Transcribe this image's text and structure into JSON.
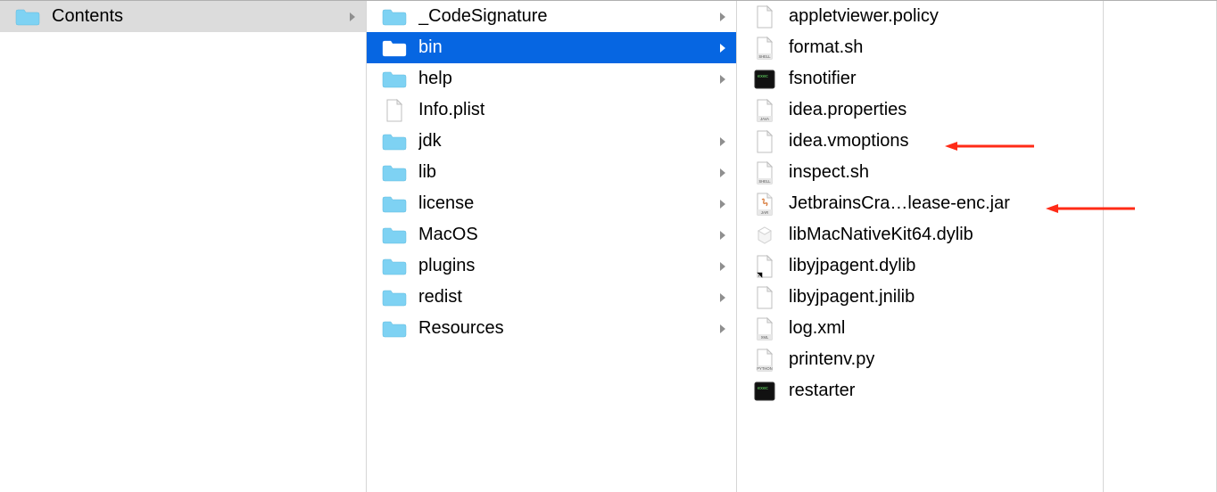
{
  "colors": {
    "folder": "#7ed2f3",
    "folder_sel": "#ffffff",
    "selection_blue": "#0666e2",
    "selection_gray": "#dcdcdc",
    "arrow": "#ff2b17"
  },
  "col1": [
    {
      "label": "Contents",
      "type": "folder",
      "expandable": true,
      "selected": "gray"
    }
  ],
  "col2": [
    {
      "label": "_CodeSignature",
      "type": "folder",
      "expandable": true
    },
    {
      "label": "bin",
      "type": "folder",
      "expandable": true,
      "selected": "blue"
    },
    {
      "label": "help",
      "type": "folder",
      "expandable": true
    },
    {
      "label": "Info.plist",
      "type": "file",
      "icon": "blank"
    },
    {
      "label": "jdk",
      "type": "folder",
      "expandable": true
    },
    {
      "label": "lib",
      "type": "folder",
      "expandable": true
    },
    {
      "label": "license",
      "type": "folder",
      "expandable": true
    },
    {
      "label": "MacOS",
      "type": "folder",
      "expandable": true
    },
    {
      "label": "plugins",
      "type": "folder",
      "expandable": true
    },
    {
      "label": "redist",
      "type": "folder",
      "expandable": true
    },
    {
      "label": "Resources",
      "type": "folder",
      "expandable": true
    }
  ],
  "col3": [
    {
      "label": "appletviewer.policy",
      "type": "file",
      "icon": "blank"
    },
    {
      "label": "format.sh",
      "type": "file",
      "icon": "shell"
    },
    {
      "label": "fsnotifier",
      "type": "file",
      "icon": "exec"
    },
    {
      "label": "idea.properties",
      "type": "file",
      "icon": "java-props"
    },
    {
      "label": "idea.vmoptions",
      "type": "file",
      "icon": "blank",
      "annotated": true
    },
    {
      "label": "inspect.sh",
      "type": "file",
      "icon": "shell"
    },
    {
      "label": "JetbrainsCra…lease-enc.jar",
      "type": "file",
      "icon": "jar",
      "annotated": true
    },
    {
      "label": "libMacNativeKit64.dylib",
      "type": "file",
      "icon": "plugin"
    },
    {
      "label": "libyjpagent.dylib",
      "type": "file",
      "icon": "alias"
    },
    {
      "label": "libyjpagent.jnilib",
      "type": "file",
      "icon": "blank"
    },
    {
      "label": "log.xml",
      "type": "file",
      "icon": "xml"
    },
    {
      "label": "printenv.py",
      "type": "file",
      "icon": "python"
    },
    {
      "label": "restarter",
      "type": "file",
      "icon": "exec"
    }
  ]
}
